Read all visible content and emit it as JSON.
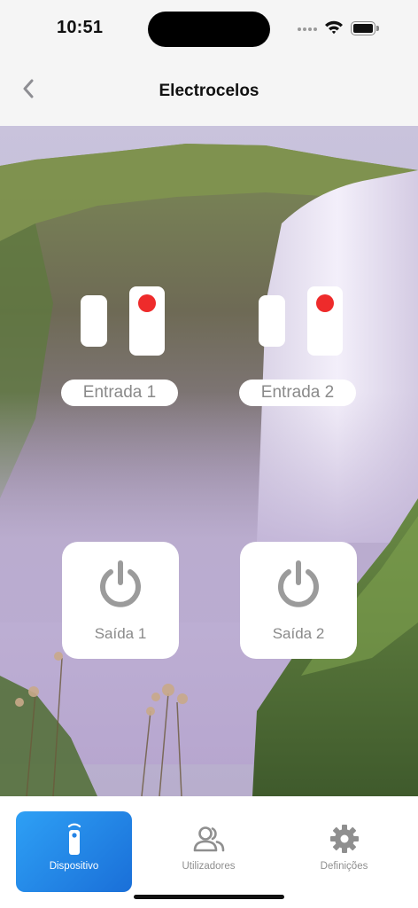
{
  "status_bar": {
    "time": "10:51",
    "icons": [
      "signal-dots-icon",
      "wifi-icon",
      "battery-icon"
    ]
  },
  "header": {
    "title": "Electrocelos",
    "back_icon": "chevron-left-icon"
  },
  "inputs": [
    {
      "label": "Entrada 1",
      "state_color": "#ee2b2b"
    },
    {
      "label": "Entrada 2",
      "state_color": "#ee2b2b"
    }
  ],
  "outputs": [
    {
      "label": "Saída 1",
      "icon": "power-icon"
    },
    {
      "label": "Saída 2",
      "icon": "power-icon"
    }
  ],
  "bottom_nav": {
    "items": [
      {
        "label": "Dispositivo",
        "icon": "remote-control-icon",
        "active": true
      },
      {
        "label": "Utilizadores",
        "icon": "users-icon",
        "active": false
      },
      {
        "label": "Definições",
        "icon": "gear-icon",
        "active": false
      }
    ]
  },
  "colors": {
    "accent_start": "#2ea0f5",
    "accent_end": "#1a6fd8",
    "indicator_active": "#ee2b2b",
    "muted_text": "#8a8a8a"
  }
}
